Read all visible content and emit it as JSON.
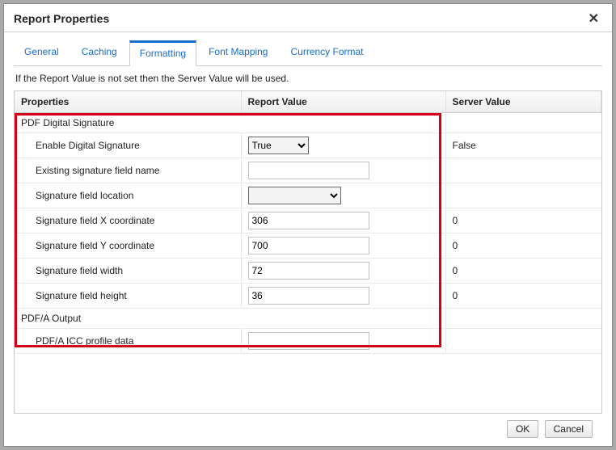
{
  "dialog": {
    "title": "Report Properties",
    "hint": "If the Report Value is not set then the Server Value will be used."
  },
  "tabs": {
    "general": "General",
    "caching": "Caching",
    "formatting": "Formatting",
    "fontmapping": "Font Mapping",
    "currency": "Currency Format"
  },
  "columns": {
    "properties": "Properties",
    "report_value": "Report Value",
    "server_value": "Server Value"
  },
  "groups": {
    "pdf_sig": "PDF Digital Signature",
    "pdfa": "PDF/A Output"
  },
  "rows": {
    "enable_sig": {
      "label": "Enable Digital Signature",
      "value": "True",
      "server": "False"
    },
    "existing_field": {
      "label": "Existing signature field name",
      "value": "",
      "server": ""
    },
    "field_loc": {
      "label": "Signature field location",
      "value": "",
      "server": ""
    },
    "x_coord": {
      "label": "Signature field X coordinate",
      "value": "306",
      "server": "0"
    },
    "y_coord": {
      "label": "Signature field Y coordinate",
      "value": "700",
      "server": "0"
    },
    "width": {
      "label": "Signature field width",
      "value": "72",
      "server": "0"
    },
    "height": {
      "label": "Signature field height",
      "value": "36",
      "server": "0"
    },
    "icc": {
      "label": "PDF/A ICC profile data",
      "value": "",
      "server": ""
    }
  },
  "buttons": {
    "ok": "OK",
    "cancel": "Cancel"
  }
}
